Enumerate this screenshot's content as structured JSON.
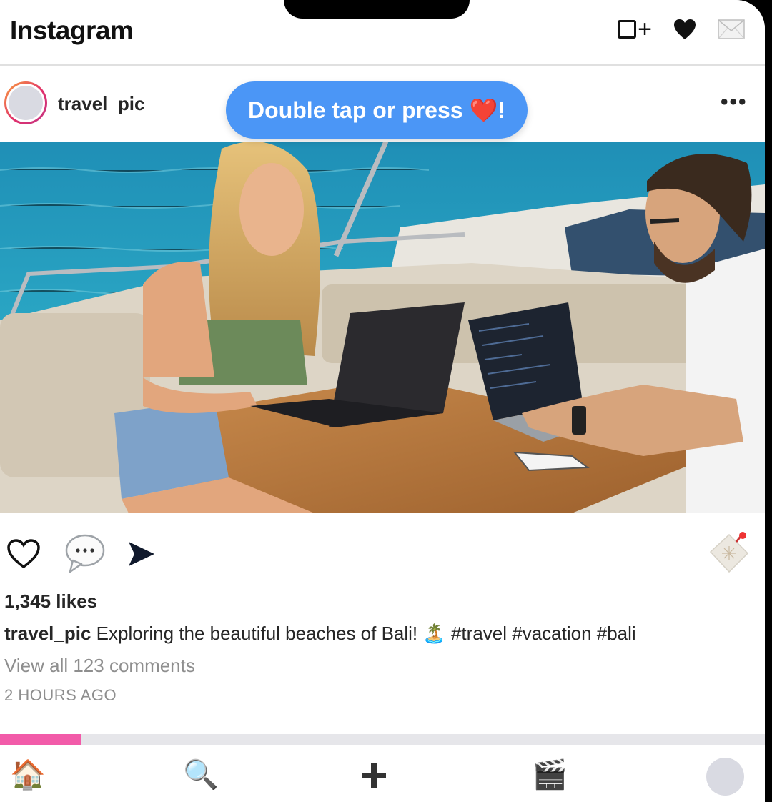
{
  "header": {
    "title": "Instagram",
    "icons": [
      "new-post-icon",
      "heart-icon",
      "mail-icon"
    ]
  },
  "post": {
    "username": "travel_pic",
    "more_label": "•••",
    "tooltip": "Double tap or press ❤️!",
    "likes": "1,345 likes",
    "caption_user": "travel_pic",
    "caption_text": "Exploring the beautiful beaches of Bali! 🏝️ #travel #vacation #bali",
    "view_comments": "View all 123 comments",
    "time_ago": "2 HOURS AGO",
    "action_icons": [
      "heart-outline-icon",
      "speech-bubble-icon",
      "send-arrow-icon",
      "bookmark-note-icon"
    ]
  },
  "progress": {
    "value": 0.107,
    "color": "#f25ba9"
  },
  "bottom_nav": {
    "home": "🏠",
    "search": "🔍",
    "add": "➕",
    "reels": "🎬",
    "icons": [
      "home-icon",
      "search-icon",
      "add-icon",
      "reels-icon",
      "profile-avatar"
    ]
  },
  "colors": {
    "accent": "#4b96f6",
    "text": "#262626",
    "muted": "#8e8e8e"
  }
}
